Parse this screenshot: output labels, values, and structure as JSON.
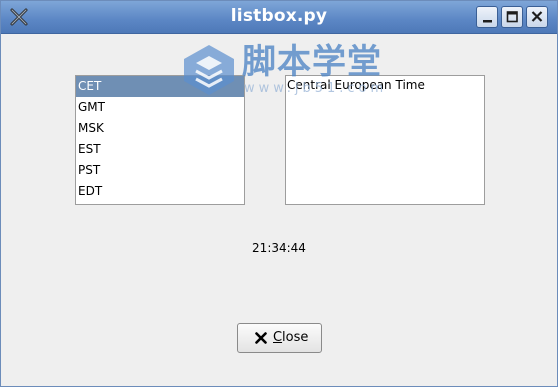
{
  "window": {
    "title": "listbox.py",
    "title_bar_color": "#5b86c4"
  },
  "listbox": {
    "items": [
      "CET",
      "GMT",
      "MSK",
      "EST",
      "PST",
      "EDT"
    ],
    "selected_index": 0,
    "selection_color": "#6f8fb4"
  },
  "description": {
    "text": "Central European Time"
  },
  "clock": {
    "time": "21:34:44"
  },
  "close_button": {
    "label_mnemonic": "C",
    "label_rest": "lose",
    "icon": "close-x-icon"
  },
  "watermark": {
    "text": "脚本学堂",
    "subtext": "www.jb51.com"
  }
}
